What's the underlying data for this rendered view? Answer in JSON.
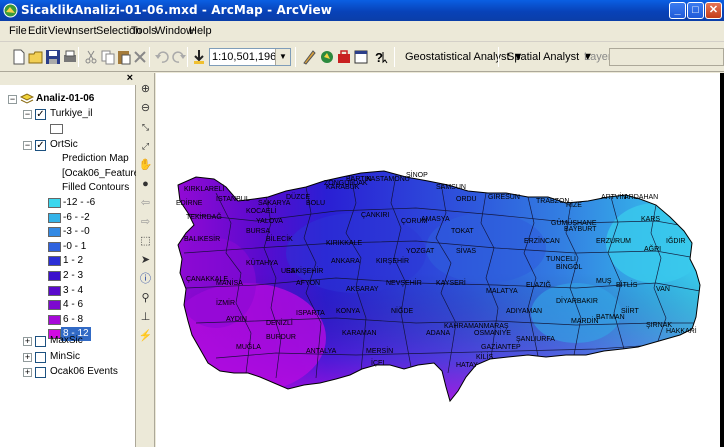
{
  "window": {
    "title": "SicaklikAnalizi-01-06.mxd - ArcMap - ArcView",
    "minimize": "_",
    "maximize": "□",
    "close": "✕"
  },
  "menu": [
    "File",
    "Edit",
    "View",
    "Insert",
    "Selection",
    "Tools",
    "Window",
    "Help"
  ],
  "toolbar": {
    "scale": "1:10,501,196",
    "geostatistical": "Geostatistical Analyst ▼",
    "spatial": "Spatial Analyst ▼",
    "layer_label": "Layer:"
  },
  "toc": {
    "close": "×",
    "dataframe": "Analiz-01-06",
    "layers": {
      "turkiye": "Turkiye_il",
      "ortsic": "OrtSic",
      "prediction": "Prediction Map",
      "features": "[Ocak06_Features]",
      "filled": "Filled Contours",
      "maxsic": "MaxSic",
      "minsic": "MinSic",
      "events": "Ocak06 Events"
    },
    "legend": [
      {
        "label": "-12 - -6",
        "color": "#3ad7ee"
      },
      {
        "label": "-6 - -2",
        "color": "#34b3e9"
      },
      {
        "label": "-3 - -0",
        "color": "#3389e4"
      },
      {
        "label": "-0 - 1",
        "color": "#2f62de"
      },
      {
        "label": "1 - 2",
        "color": "#2c2fd6"
      },
      {
        "label": "2 - 3",
        "color": "#3b10cc"
      },
      {
        "label": "3 - 4",
        "color": "#5a0acc"
      },
      {
        "label": "4 - 6",
        "color": "#7d09d0"
      },
      {
        "label": "6 - 8",
        "color": "#a608d8"
      },
      {
        "label": "8 - 12",
        "color": "#d10be3"
      }
    ]
  },
  "map_labels": [
    "KIRKLARELİ",
    "EDİRNE",
    "TEKİRDAĞ",
    "İSTANBUL",
    "KOCAELİ",
    "SAKARYA",
    "DÜZCE",
    "BOLU",
    "ZONGULDAK",
    "BARTIN",
    "KASTAMONU",
    "SİNOP",
    "SAMSUN",
    "ORDU",
    "GİRESUN",
    "TRABZON",
    "RİZE",
    "ARTVİN",
    "ARDAHAN",
    "KARS",
    "IĞDIR",
    "AĞRI",
    "ERZURUM",
    "BAYBURT",
    "GÜMÜŞHANE",
    "ERZİNCAN",
    "TUNCELİ",
    "BİNGÖL",
    "MUŞ",
    "BİTLİS",
    "VAN",
    "HAKKARİ",
    "ŞIRNAK",
    "SİİRT",
    "BATMAN",
    "MARDİN",
    "DİYARBAKIR",
    "ELAZIĞ",
    "MALATYA",
    "ADIYAMAN",
    "ŞANLIURFA",
    "GAZİANTEP",
    "KİLİS",
    "HATAY",
    "OSMANİYE",
    "ADANA",
    "MERSİN",
    "KARAMAN",
    "KONYA",
    "NİĞDE",
    "AKSARAY",
    "NEVŞEHİR",
    "KAYSERİ",
    "KIRŞEHİR",
    "YOZGAT",
    "SİVAS",
    "TOKAT",
    "AMASYA",
    "ÇORUM",
    "ÇANKIRI",
    "KIRIKKALE",
    "ANKARA",
    "ESKİŞEHİR",
    "BİLECİK",
    "BURSA",
    "YALOVA",
    "BALIKESİR",
    "ÇANAKKALE",
    "MANİSA",
    "İZMİR",
    "AYDIN",
    "MUĞLA",
    "DENİZLİ",
    "USAK",
    "KÜTAHYA",
    "AFYON",
    "ISPARTA",
    "BURDUR",
    "ANTALYA",
    "İÇEL",
    "KARABÜK",
    "KAHRAMANMARAŞ"
  ]
}
